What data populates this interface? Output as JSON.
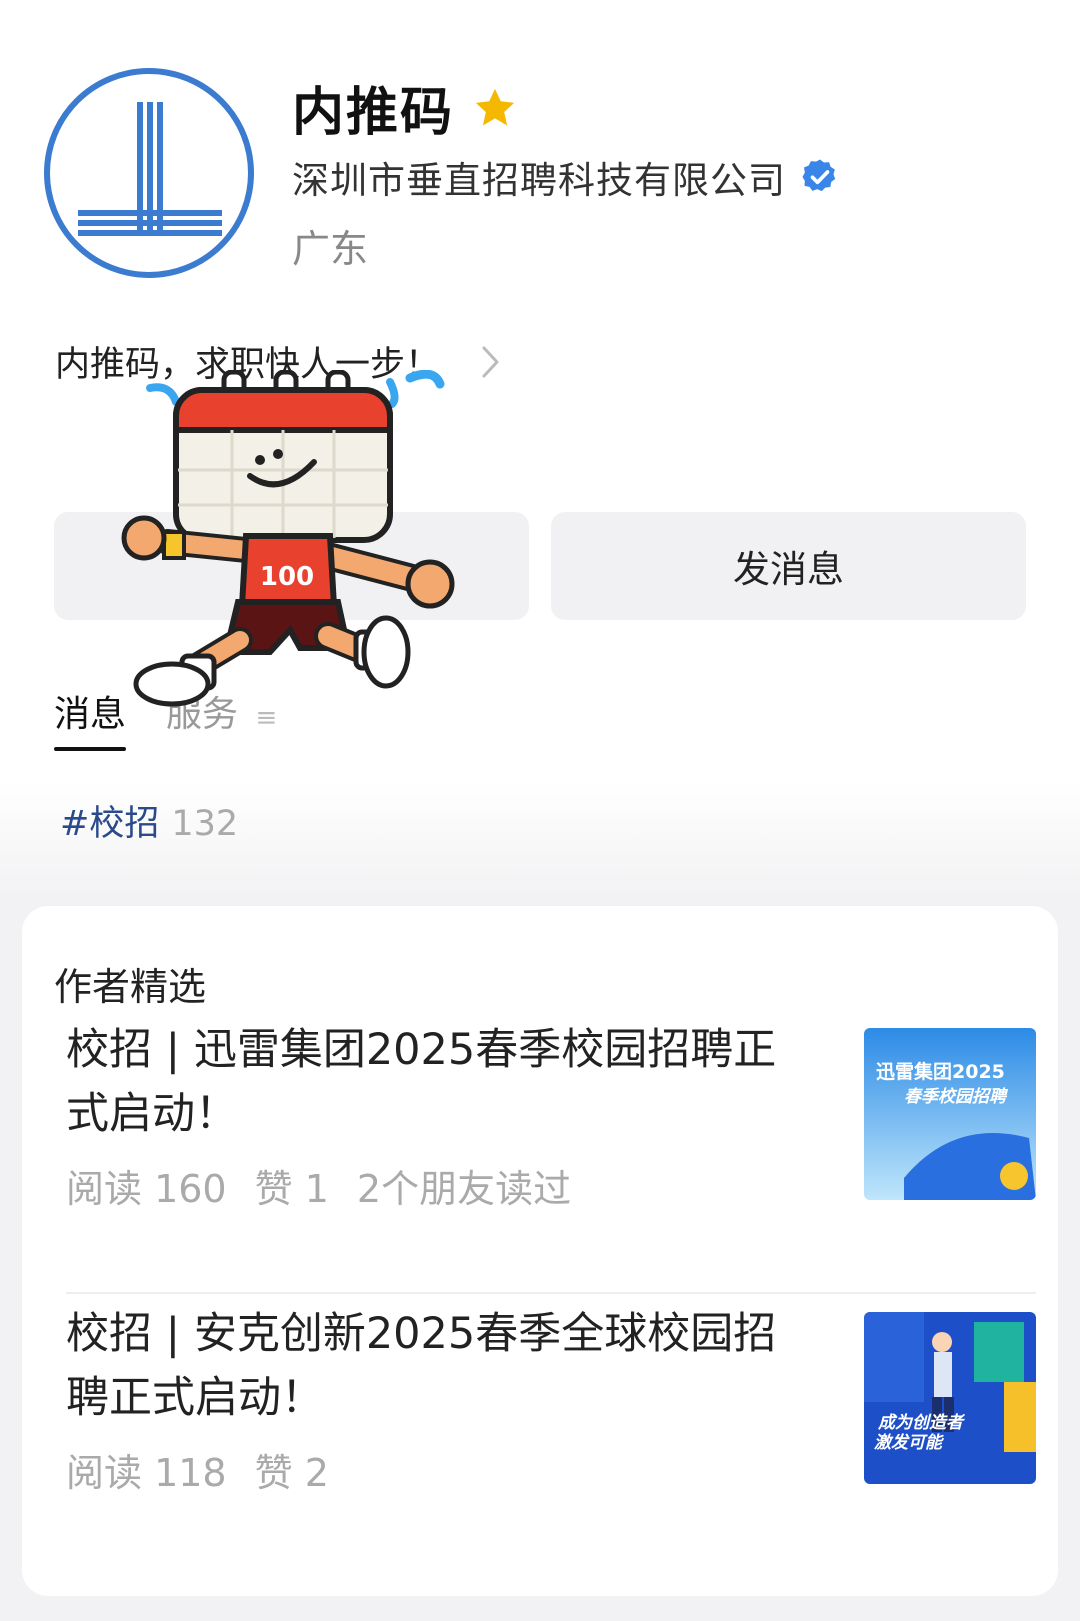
{
  "profile": {
    "name": "内推码",
    "company": "深圳市垂直招聘科技有限公司",
    "region": "广东",
    "bio": "内推码，求职快人一步！"
  },
  "buttons": {
    "message": "发消息"
  },
  "tabs": [
    {
      "label": "消息",
      "active": true
    },
    {
      "label": "服务",
      "active": false
    }
  ],
  "tag": {
    "label": "#校招",
    "count": "132"
  },
  "featured": {
    "title": "作者精选",
    "articles": [
      {
        "title": "校招 | 迅雷集团2025春季校园招聘正式启动！",
        "reads": "阅读 160",
        "likes": "赞 1",
        "friends": "2个朋友读过",
        "thumb_text_1": "迅雷集团2025",
        "thumb_text_2": "春季校园招聘"
      },
      {
        "title": "校招 | 安克创新2025春季全球校园招聘正式启动！",
        "reads": "阅读 118",
        "likes": "赞 2",
        "thumb_text_1": "成为创造者",
        "thumb_text_2": "激发可能"
      }
    ]
  },
  "sticker": {
    "jersey_number": "100"
  },
  "colors": {
    "accent_blue": "#3b7bd0",
    "star": "#f5b800",
    "verified": "#3a86e8",
    "tag_text": "#2a4a8c"
  }
}
